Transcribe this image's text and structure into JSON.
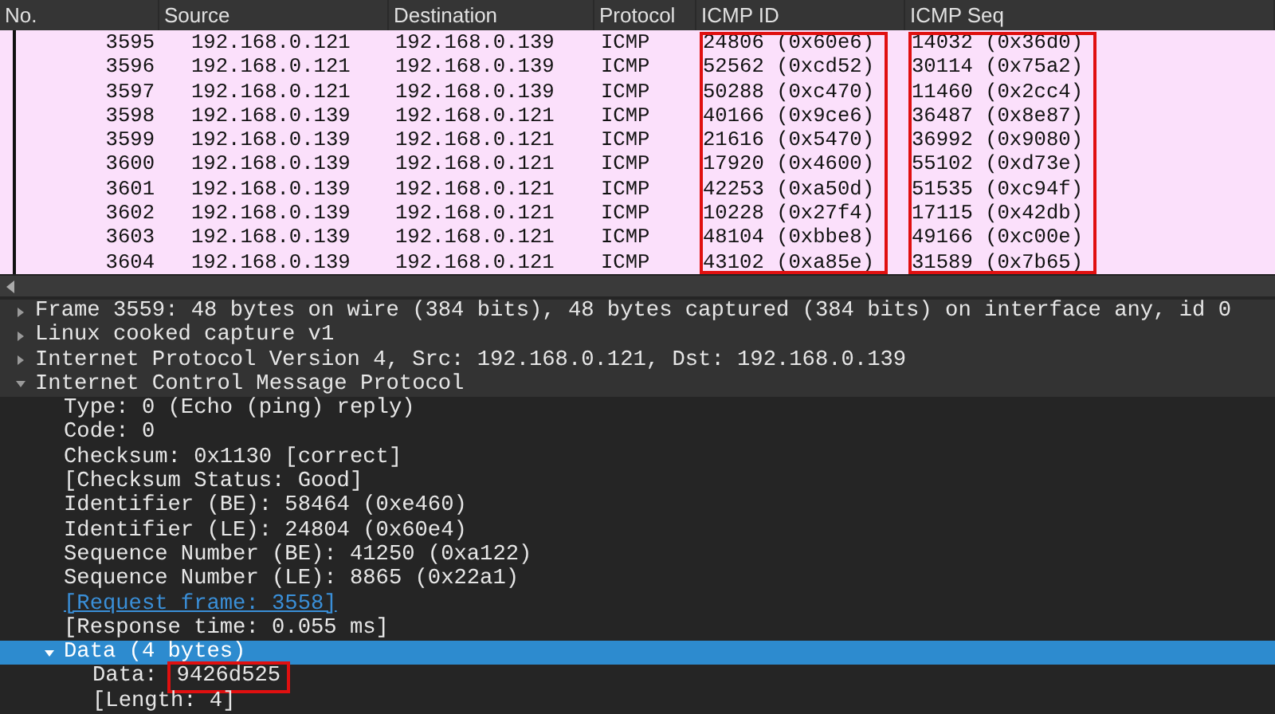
{
  "packet_list": {
    "columns": [
      {
        "label": "No."
      },
      {
        "label": "Source"
      },
      {
        "label": "Destination"
      },
      {
        "label": "Protocol"
      },
      {
        "label": "ICMP ID",
        "highlighted": true
      },
      {
        "label": "ICMP Seq",
        "highlighted": true
      }
    ],
    "rows": [
      [
        "3595",
        "192.168.0.121",
        "192.168.0.139",
        "ICMP",
        "24806 (0x60e6)",
        "14032 (0x36d0)"
      ],
      [
        "3596",
        "192.168.0.121",
        "192.168.0.139",
        "ICMP",
        "52562 (0xcd52)",
        "30114 (0x75a2)"
      ],
      [
        "3597",
        "192.168.0.121",
        "192.168.0.139",
        "ICMP",
        "50288 (0xc470)",
        "11460 (0x2cc4)"
      ],
      [
        "3598",
        "192.168.0.139",
        "192.168.0.121",
        "ICMP",
        "40166 (0x9ce6)",
        "36487 (0x8e87)"
      ],
      [
        "3599",
        "192.168.0.139",
        "192.168.0.121",
        "ICMP",
        "21616 (0x5470)",
        "36992 (0x9080)"
      ],
      [
        "3600",
        "192.168.0.139",
        "192.168.0.121",
        "ICMP",
        "17920 (0x4600)",
        "55102 (0xd73e)"
      ],
      [
        "3601",
        "192.168.0.139",
        "192.168.0.121",
        "ICMP",
        "42253 (0xa50d)",
        "51535 (0xc94f)"
      ],
      [
        "3602",
        "192.168.0.139",
        "192.168.0.121",
        "ICMP",
        "10228 (0x27f4)",
        "17115 (0x42db)"
      ],
      [
        "3603",
        "192.168.0.139",
        "192.168.0.121",
        "ICMP",
        "48104 (0xbbe8)",
        "49166 (0xc00e)"
      ],
      [
        "3604",
        "192.168.0.139",
        "192.168.0.121",
        "ICMP",
        "43102 (0xa85e)",
        "31589 (0x7b65)"
      ]
    ]
  },
  "details": [
    {
      "label": "Frame 3559: 48 bytes on wire (384 bits), 48 bytes captured (384 bits) on interface any, id 0",
      "expanded": false,
      "selected": false
    },
    {
      "label": "Linux cooked capture v1",
      "expanded": false,
      "selected": false
    },
    {
      "label": "Internet Protocol Version 4, Src: 192.168.0.121, Dst: 192.168.0.139",
      "expanded": false,
      "selected": false
    },
    {
      "label": "Internet Control Message Protocol",
      "expanded": true,
      "selected": false,
      "children": [
        {
          "label": "Type: 0 (Echo (ping) reply)",
          "selected": false
        },
        {
          "label": "Code: 0",
          "selected": false
        },
        {
          "label": "Checksum: 0x1130 [correct]",
          "selected": false
        },
        {
          "label": "[Checksum Status: Good]",
          "selected": false
        },
        {
          "label": "Identifier (BE): 58464 (0xe460)",
          "selected": false
        },
        {
          "label": "Identifier (LE): 24804 (0x60e4)",
          "selected": false
        },
        {
          "label": "Sequence Number (BE): 41250 (0xa122)",
          "selected": false
        },
        {
          "label": "Sequence Number (LE): 8865 (0x22a1)",
          "selected": false
        },
        {
          "label": "[Request frame: 3558]",
          "selected": false,
          "kind": "link"
        },
        {
          "label": "[Response time: 0.055 ms]",
          "selected": false
        },
        {
          "label": "Data (4 bytes)",
          "expanded": true,
          "selected": true,
          "children": [
            {
              "label": "Data:",
              "value": "9426d525",
              "highlighted": true,
              "selected": false
            },
            {
              "label": "[Length: 4]",
              "selected": false
            }
          ]
        }
      ]
    }
  ]
}
